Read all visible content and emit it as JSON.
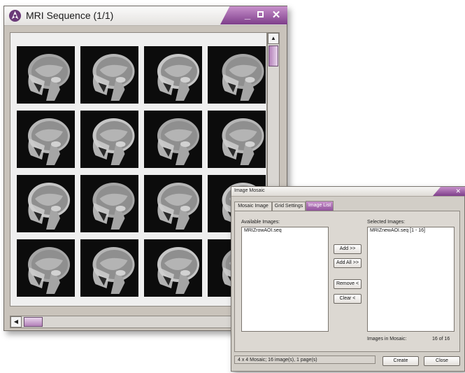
{
  "mri_window": {
    "title": "MRI Sequence (1/1)",
    "controls": {
      "minimize": "_",
      "close": "✕"
    },
    "scroll": {
      "up": "▲",
      "left": "◀"
    },
    "grid": {
      "rows": 4,
      "columns": 4,
      "image_count": 16
    }
  },
  "mosaic_dialog": {
    "title": "Image Mosaic",
    "close": "✕",
    "tabs": [
      "Mosaic Image",
      "Grid Settings",
      "Image List"
    ],
    "active_tab": "Image List",
    "available_label": "Available Images:",
    "available_items": [
      "MRIZrowAOI.seq"
    ],
    "selected_label": "Selected Images:",
    "selected_items": [
      "MRIZnewAOI.seq [1 - 16]"
    ],
    "buttons": {
      "add": "Add >>",
      "add_all": "Add All >>",
      "remove": "Remove <",
      "clear": "Clear <"
    },
    "images_in_mosaic_label": "Images in Mosaic:",
    "images_in_mosaic_value": "16 of 16",
    "status": "4 x 4 Mosaic; 16 image(s), 1 page(s)",
    "create": "Create",
    "close_button": "Close"
  },
  "colors": {
    "accent": "#9a5aa6",
    "window_bg": "#c9c3bb",
    "dialog_bg": "#d2cec7"
  }
}
